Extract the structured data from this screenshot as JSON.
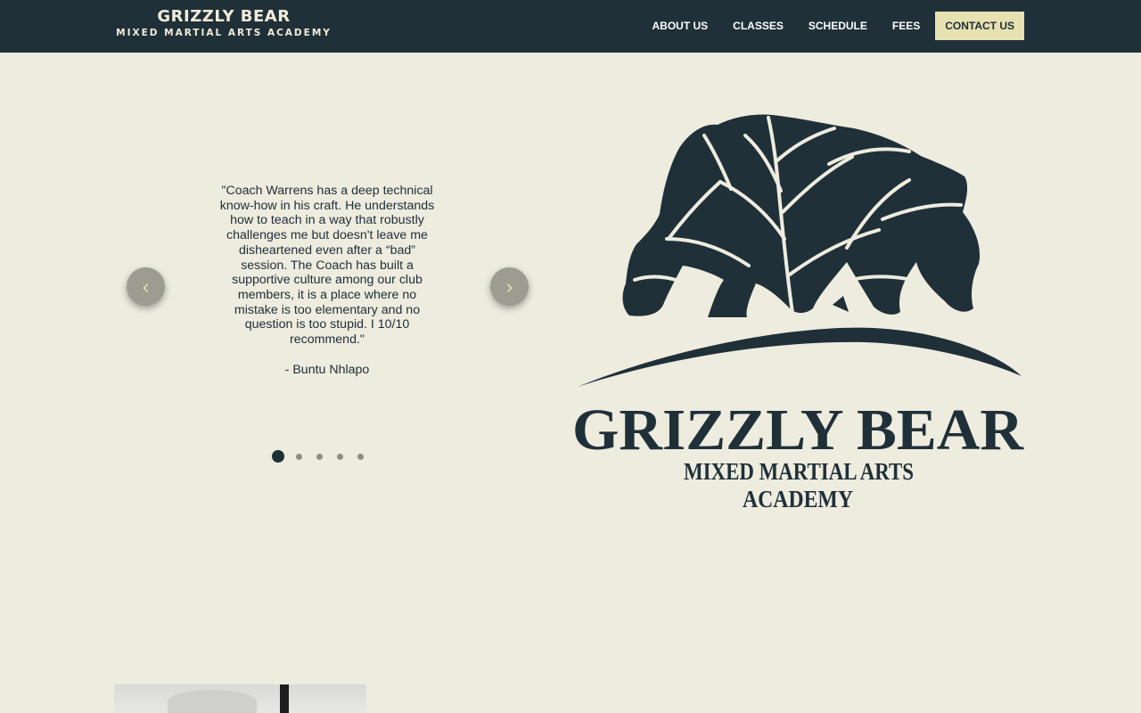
{
  "brand": {
    "title": "GRIZZLY BEAR",
    "subtitle": "MIXED MARTIAL ARTS ACADEMY"
  },
  "nav": {
    "items": [
      {
        "label": "ABOUT US"
      },
      {
        "label": "CLASSES"
      },
      {
        "label": "SCHEDULE"
      },
      {
        "label": "FEES"
      }
    ],
    "cta_label": "CONTACT US"
  },
  "testimonial": {
    "quote": "\"Coach Warrens has a deep technical know-how in his craft. He understands how to teach in a way that robustly challenges me but doesn't leave me disheartened even after a “bad” session. The Coach has built a supportive culture among our club members, it is a place where no mistake is too elementary and no question is too stupid. I 10/10 recommend.\"",
    "author": "- Buntu Nhlapo"
  },
  "carousel": {
    "prev_icon": "chevron-left-icon",
    "next_icon": "chevron-right-icon",
    "prev_glyph": "‹",
    "next_glyph": "›",
    "slide_count": 5,
    "active_index": 0
  },
  "logo": {
    "title": "GRIZZLY BEAR",
    "line1": "MIXED MARTIAL ARTS",
    "line2": "ACADEMY"
  },
  "colors": {
    "navy": "#203039",
    "cream": "#eeecdf",
    "accent": "#e7e1b1",
    "arrow_bg": "#9c9c90"
  }
}
